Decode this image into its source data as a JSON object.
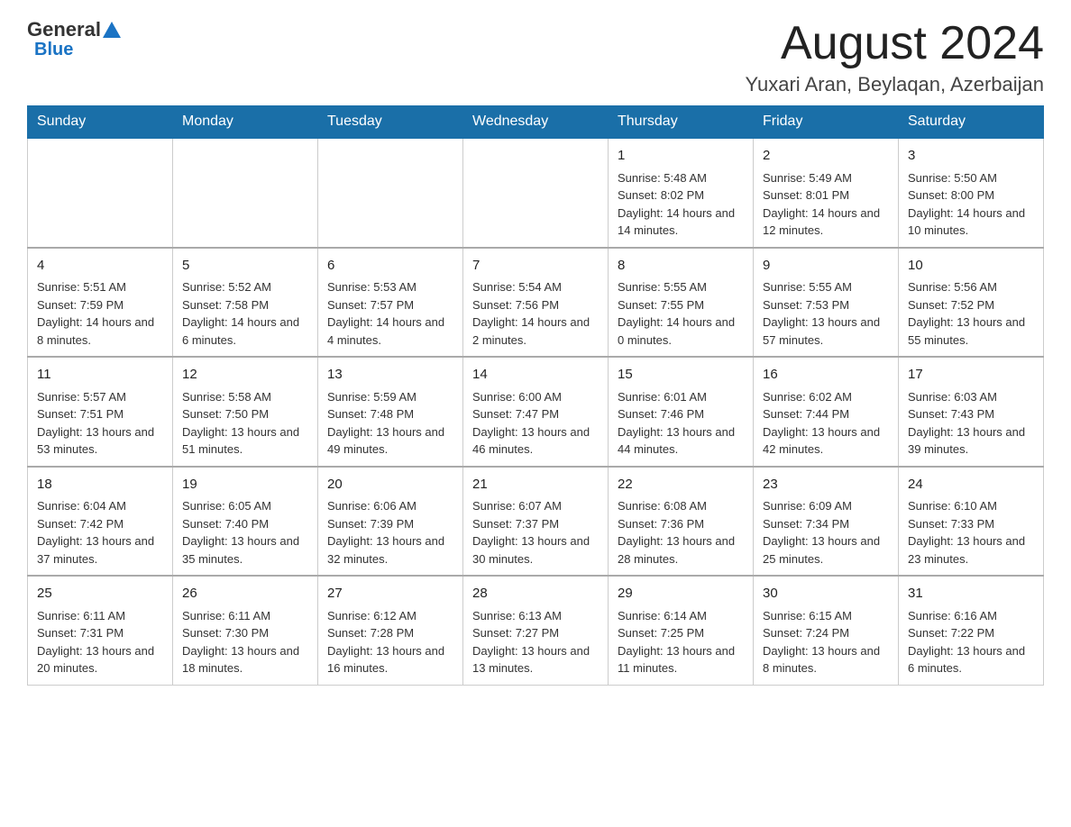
{
  "header": {
    "logo_general": "General",
    "logo_blue": "Blue",
    "month_title": "August 2024",
    "location": "Yuxari Aran, Beylaqan, Azerbaijan"
  },
  "days_of_week": [
    "Sunday",
    "Monday",
    "Tuesday",
    "Wednesday",
    "Thursday",
    "Friday",
    "Saturday"
  ],
  "weeks": [
    [
      {
        "day": "",
        "info": ""
      },
      {
        "day": "",
        "info": ""
      },
      {
        "day": "",
        "info": ""
      },
      {
        "day": "",
        "info": ""
      },
      {
        "day": "1",
        "info": "Sunrise: 5:48 AM\nSunset: 8:02 PM\nDaylight: 14 hours and 14 minutes."
      },
      {
        "day": "2",
        "info": "Sunrise: 5:49 AM\nSunset: 8:01 PM\nDaylight: 14 hours and 12 minutes."
      },
      {
        "day": "3",
        "info": "Sunrise: 5:50 AM\nSunset: 8:00 PM\nDaylight: 14 hours and 10 minutes."
      }
    ],
    [
      {
        "day": "4",
        "info": "Sunrise: 5:51 AM\nSunset: 7:59 PM\nDaylight: 14 hours and 8 minutes."
      },
      {
        "day": "5",
        "info": "Sunrise: 5:52 AM\nSunset: 7:58 PM\nDaylight: 14 hours and 6 minutes."
      },
      {
        "day": "6",
        "info": "Sunrise: 5:53 AM\nSunset: 7:57 PM\nDaylight: 14 hours and 4 minutes."
      },
      {
        "day": "7",
        "info": "Sunrise: 5:54 AM\nSunset: 7:56 PM\nDaylight: 14 hours and 2 minutes."
      },
      {
        "day": "8",
        "info": "Sunrise: 5:55 AM\nSunset: 7:55 PM\nDaylight: 14 hours and 0 minutes."
      },
      {
        "day": "9",
        "info": "Sunrise: 5:55 AM\nSunset: 7:53 PM\nDaylight: 13 hours and 57 minutes."
      },
      {
        "day": "10",
        "info": "Sunrise: 5:56 AM\nSunset: 7:52 PM\nDaylight: 13 hours and 55 minutes."
      }
    ],
    [
      {
        "day": "11",
        "info": "Sunrise: 5:57 AM\nSunset: 7:51 PM\nDaylight: 13 hours and 53 minutes."
      },
      {
        "day": "12",
        "info": "Sunrise: 5:58 AM\nSunset: 7:50 PM\nDaylight: 13 hours and 51 minutes."
      },
      {
        "day": "13",
        "info": "Sunrise: 5:59 AM\nSunset: 7:48 PM\nDaylight: 13 hours and 49 minutes."
      },
      {
        "day": "14",
        "info": "Sunrise: 6:00 AM\nSunset: 7:47 PM\nDaylight: 13 hours and 46 minutes."
      },
      {
        "day": "15",
        "info": "Sunrise: 6:01 AM\nSunset: 7:46 PM\nDaylight: 13 hours and 44 minutes."
      },
      {
        "day": "16",
        "info": "Sunrise: 6:02 AM\nSunset: 7:44 PM\nDaylight: 13 hours and 42 minutes."
      },
      {
        "day": "17",
        "info": "Sunrise: 6:03 AM\nSunset: 7:43 PM\nDaylight: 13 hours and 39 minutes."
      }
    ],
    [
      {
        "day": "18",
        "info": "Sunrise: 6:04 AM\nSunset: 7:42 PM\nDaylight: 13 hours and 37 minutes."
      },
      {
        "day": "19",
        "info": "Sunrise: 6:05 AM\nSunset: 7:40 PM\nDaylight: 13 hours and 35 minutes."
      },
      {
        "day": "20",
        "info": "Sunrise: 6:06 AM\nSunset: 7:39 PM\nDaylight: 13 hours and 32 minutes."
      },
      {
        "day": "21",
        "info": "Sunrise: 6:07 AM\nSunset: 7:37 PM\nDaylight: 13 hours and 30 minutes."
      },
      {
        "day": "22",
        "info": "Sunrise: 6:08 AM\nSunset: 7:36 PM\nDaylight: 13 hours and 28 minutes."
      },
      {
        "day": "23",
        "info": "Sunrise: 6:09 AM\nSunset: 7:34 PM\nDaylight: 13 hours and 25 minutes."
      },
      {
        "day": "24",
        "info": "Sunrise: 6:10 AM\nSunset: 7:33 PM\nDaylight: 13 hours and 23 minutes."
      }
    ],
    [
      {
        "day": "25",
        "info": "Sunrise: 6:11 AM\nSunset: 7:31 PM\nDaylight: 13 hours and 20 minutes."
      },
      {
        "day": "26",
        "info": "Sunrise: 6:11 AM\nSunset: 7:30 PM\nDaylight: 13 hours and 18 minutes."
      },
      {
        "day": "27",
        "info": "Sunrise: 6:12 AM\nSunset: 7:28 PM\nDaylight: 13 hours and 16 minutes."
      },
      {
        "day": "28",
        "info": "Sunrise: 6:13 AM\nSunset: 7:27 PM\nDaylight: 13 hours and 13 minutes."
      },
      {
        "day": "29",
        "info": "Sunrise: 6:14 AM\nSunset: 7:25 PM\nDaylight: 13 hours and 11 minutes."
      },
      {
        "day": "30",
        "info": "Sunrise: 6:15 AM\nSunset: 7:24 PM\nDaylight: 13 hours and 8 minutes."
      },
      {
        "day": "31",
        "info": "Sunrise: 6:16 AM\nSunset: 7:22 PM\nDaylight: 13 hours and 6 minutes."
      }
    ]
  ]
}
